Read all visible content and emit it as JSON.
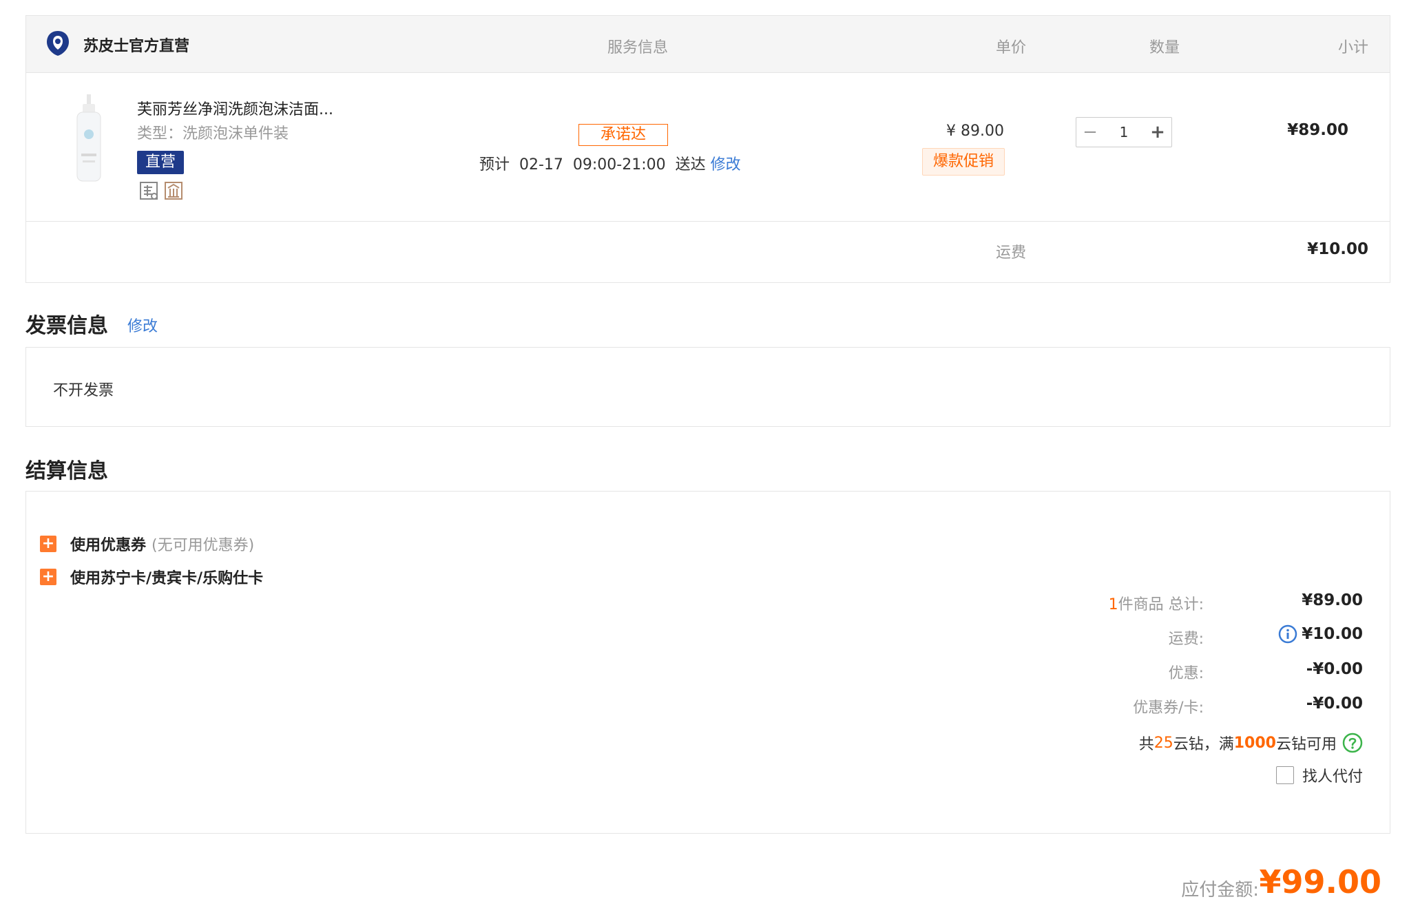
{
  "order": {
    "store_name": "苏皮士官方直营",
    "columns": {
      "service": "服务信息",
      "unit_price": "单价",
      "quantity": "数量",
      "subtotal": "小计"
    },
    "item": {
      "name": "芙丽芳丝净润洗颜泡沫洁面...",
      "type": "类型：洗颜泡沫单件装",
      "badge": "直营",
      "promise_tag": "承诺达",
      "delivery_prefix": "预计  02-17  09:00-21:00  送达 ",
      "delivery_edit": "修改",
      "unit_price": "¥ 89.00",
      "promo_tag": "爆款促销",
      "qty_minus": "−",
      "qty": "1",
      "qty_plus": "+",
      "subtotal": "¥89.00"
    },
    "freight_label": "运费",
    "freight_value": "¥10.00"
  },
  "invoice": {
    "title": "发票信息",
    "edit": "修改",
    "value": "不开发票"
  },
  "settlement": {
    "title": "结算信息",
    "coupon_label": "使用优惠券",
    "coupon_sub": "(无可用优惠券)",
    "card_label": "使用苏宁卡/贵宾卡/乐购仕卡",
    "count": "1",
    "goods_total_label": "件商品 总计:",
    "goods_total_value": "¥89.00",
    "freight_label": "运费:",
    "freight_value": "¥10.00",
    "discount_label": "优惠:",
    "discount_value": "-¥0.00",
    "coupon_card_label": "优惠券/卡:",
    "coupon_card_value": "-¥0.00",
    "yunzuan_prefix": "共 ",
    "yunzuan_count": "25",
    "yunzuan_mid": " 云钻，满 ",
    "yunzuan_threshold": "1000",
    "yunzuan_suffix": " 云钻可用",
    "daipay_label": "找人代付"
  },
  "payable": {
    "label": "应付金额:",
    "value": "¥99.00"
  },
  "colors": {
    "accent": "#ff6600",
    "link": "#3a7bd5",
    "badge": "#1e3a8a"
  },
  "icons": [
    "store-logo-icon",
    "product-thumbnail",
    "return-icon",
    "price-protect-icon",
    "plus-square-icon",
    "info-icon",
    "help-icon",
    "checkbox"
  ]
}
